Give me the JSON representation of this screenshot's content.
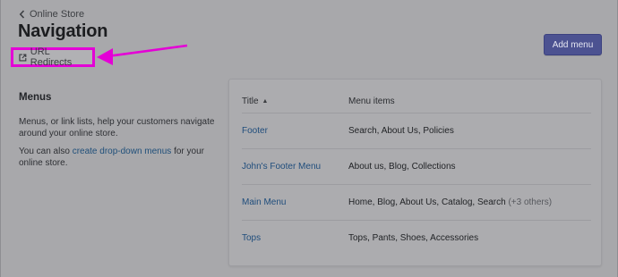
{
  "breadcrumb": {
    "label": "Online Store"
  },
  "header": {
    "title": "Navigation",
    "add_button": "Add menu"
  },
  "redirect_link": {
    "label": "URL Redirects"
  },
  "annotation": {
    "color": "#e400d6"
  },
  "section": {
    "title": "Menus",
    "description": "Menus, or link lists, help your customers navigate around your online store.",
    "hint_prefix": "You can also ",
    "hint_link": "create drop-down menus",
    "hint_suffix": " for your online store."
  },
  "table": {
    "columns": {
      "title": "Title",
      "sort_indicator": "▲",
      "items": "Menu items"
    },
    "rows": [
      {
        "name": "Footer",
        "items": "Search, About Us, Policies",
        "others": ""
      },
      {
        "name": "John's Footer Menu",
        "items": "About us, Blog, Collections",
        "others": ""
      },
      {
        "name": "Main Menu",
        "items": "Home, Blog, About Us, Catalog, Search",
        "others": "(+3 others)"
      },
      {
        "name": "Tops",
        "items": "Tops, Pants, Shoes, Accessories",
        "others": ""
      }
    ]
  },
  "colors": {
    "primary_button": "#4c5291",
    "link": "#1f4d7c",
    "overlay_bg": "#a8a8ab"
  },
  "icons": {
    "back": "chevron-left-icon",
    "external": "external-link-icon"
  }
}
